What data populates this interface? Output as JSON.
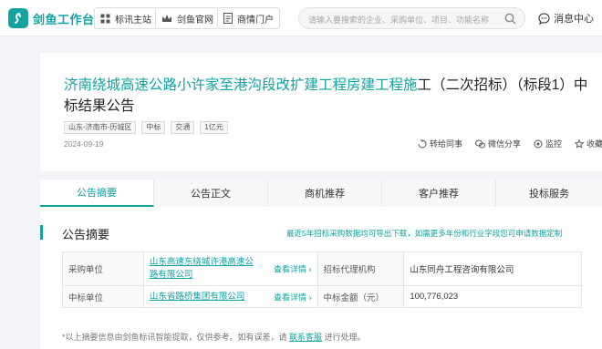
{
  "header": {
    "logo_text": "剑鱼工作台",
    "nav": [
      {
        "label": "标讯主站",
        "icon": "grid-icon"
      },
      {
        "label": "剑鱼官网",
        "icon": "crown-icon"
      },
      {
        "label": "商情门户",
        "icon": "document-icon"
      }
    ],
    "search_placeholder": "请输入要搜索的企业、采购单位、项目、功能名称",
    "message_label": "消息中心"
  },
  "notice": {
    "title_highlight": "济南绕城高速公路小许家至港沟段改扩建工程房建工程施",
    "title_rest": "工（二次招标）（标段1）中标结果公告",
    "tags": [
      "山东-济南市-历城区",
      "中标",
      "交通",
      "1亿元"
    ],
    "date": "2024-09-19",
    "actions": [
      {
        "label": "转给同事",
        "icon": "forward-icon"
      },
      {
        "label": "微信分享",
        "icon": "wechat-icon"
      },
      {
        "label": "监控",
        "icon": "monitor-icon"
      },
      {
        "label": "收藏",
        "icon": "star-icon"
      }
    ]
  },
  "tabs": [
    "公告摘要",
    "公告正文",
    "商机推荐",
    "客户推荐",
    "投标服务"
  ],
  "active_tab": 0,
  "summary": {
    "title": "公告摘要",
    "export_note": "最近5年招标采购数据均可导出下载，如需更多年份和行业字段您可申请数据定制",
    "details_label": "查看详情",
    "rows": [
      {
        "label1": "采购单位",
        "value1": "山东高速东绕城许港高速公路有限公司",
        "label2": "招标代理机构",
        "value2": "山东同舟工程咨询有限公司"
      },
      {
        "label1": "中标单位",
        "value1": "山东省路桥集团有限公司",
        "label2": "中标金额（元）",
        "value2": "100,776,023"
      }
    ],
    "footnote_pre": "*以上摘要信息由剑鱼标讯智能提取，仅供参考。如有误差，请",
    "footnote_link": "联系客服",
    "footnote_post": "进行处理。"
  },
  "colors": {
    "accent": "#12a2a2"
  }
}
